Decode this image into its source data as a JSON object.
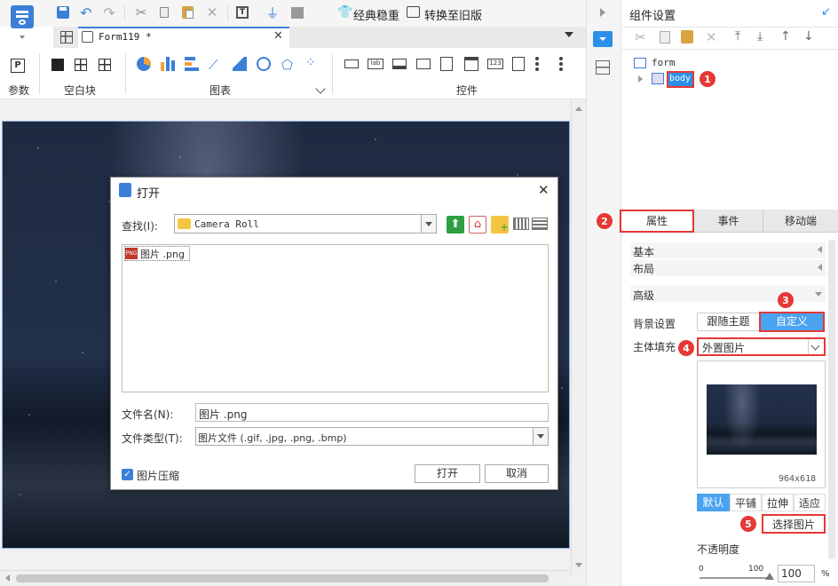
{
  "toolbar": {
    "classic_label": "经典稳重",
    "switch_label": "转换至旧版"
  },
  "tab": {
    "title": "Form119 *"
  },
  "ribbon": {
    "group_param": "参数",
    "group_blank": "空白块",
    "group_chart": "图表",
    "group_widget": "控件"
  },
  "dialog": {
    "title": "打开",
    "lookin_label": "查找(I):",
    "lookin_value": "Camera Roll",
    "file_item": "图片 .png",
    "filename_label": "文件名(N):",
    "filename_value": "图片 .png",
    "filetype_label": "文件类型(T):",
    "filetype_value": "图片文件 (.gif, .jpg, .png, .bmp)",
    "compress_label": "图片压缩",
    "open_btn": "打开",
    "cancel_btn": "取消"
  },
  "panel": {
    "title": "组件设置",
    "tree_form": "form",
    "tree_body": "body",
    "tabs": [
      "属性",
      "事件",
      "移动端"
    ],
    "sec_basic": "基本",
    "sec_layout": "布局",
    "sec_advanced": "高级",
    "bg_label": "背景设置",
    "bg_follow": "跟随主题",
    "bg_custom": "自定义",
    "fill_label": "主体填充",
    "fill_value": "外置图片",
    "img_size": "964x618",
    "modes": [
      "默认",
      "平铺",
      "拉伸",
      "适应"
    ],
    "select_img": "选择图片",
    "opacity_label": "不透明度",
    "opacity_min": "0",
    "opacity_max": "100",
    "opacity_value": "100",
    "opacity_unit": "%"
  },
  "badges": [
    "1",
    "2",
    "3",
    "4",
    "5"
  ],
  "colors": {
    "accent": "#2c8fe8",
    "red": "#e53935",
    "night": "#1b2638"
  }
}
